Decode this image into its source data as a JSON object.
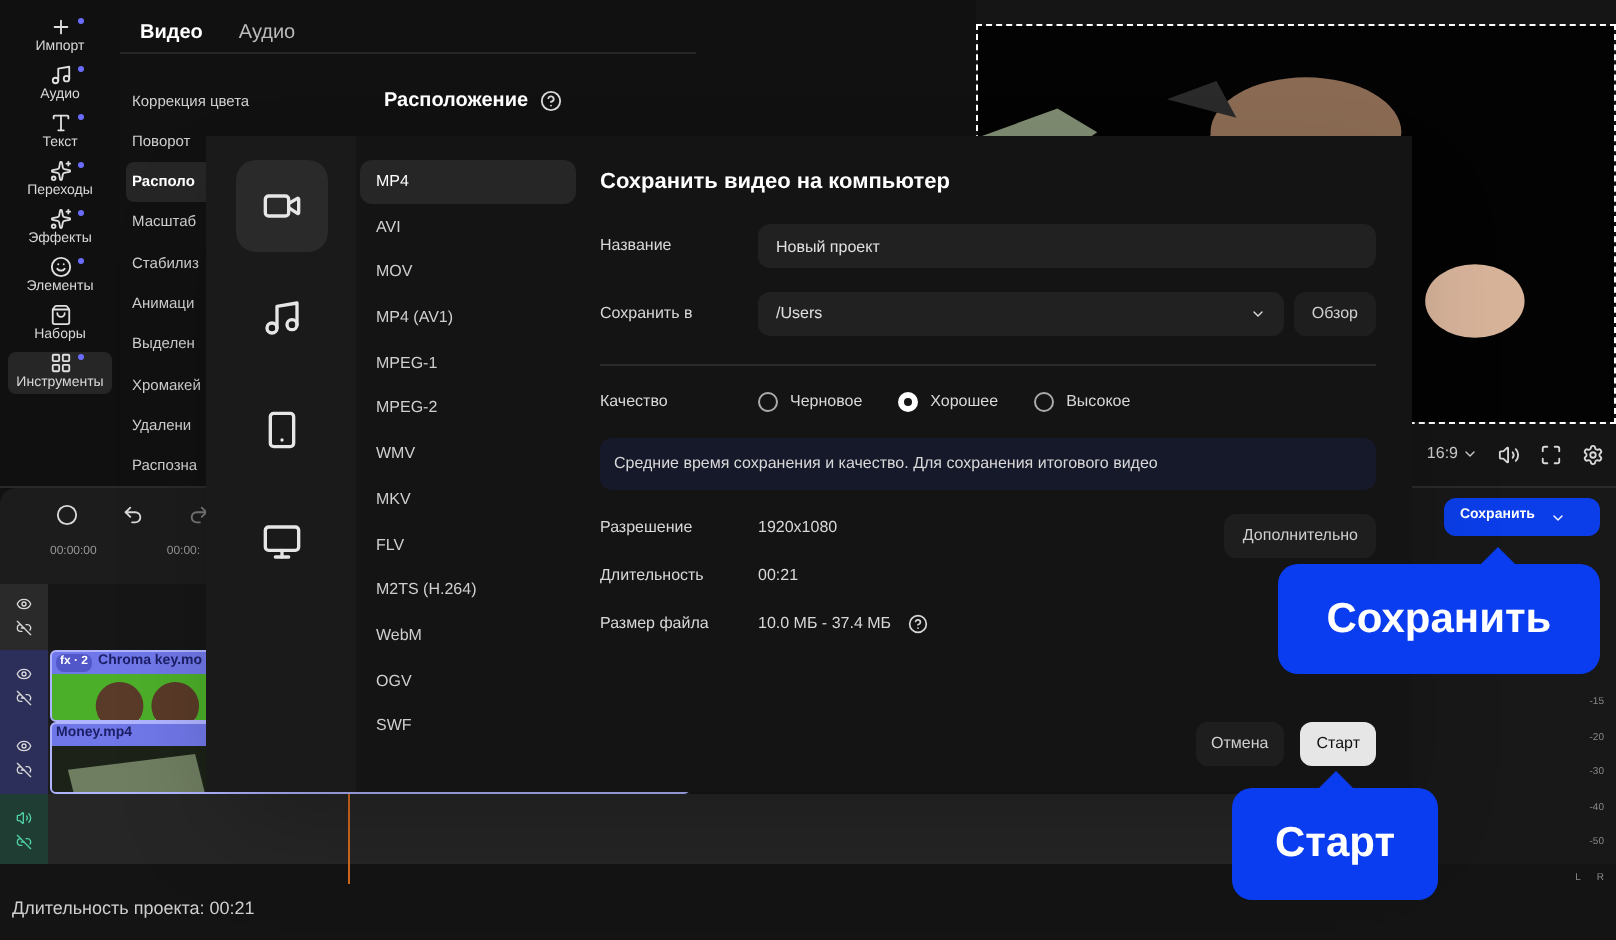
{
  "tool_rail": [
    {
      "label": "Импорт",
      "selected": false,
      "dot": true
    },
    {
      "label": "Аудио",
      "selected": false,
      "dot": true
    },
    {
      "label": "Текст",
      "selected": false,
      "dot": true
    },
    {
      "label": "Переходы",
      "selected": false,
      "dot": true
    },
    {
      "label": "Эффекты",
      "selected": false,
      "dot": true
    },
    {
      "label": "Элементы",
      "selected": false,
      "dot": true
    },
    {
      "label": "Наборы",
      "selected": false,
      "dot": false
    },
    {
      "label": "Инструменты",
      "selected": true,
      "dot": true
    }
  ],
  "settings_panel": {
    "tabs": [
      {
        "label": "Видео",
        "selected": true
      },
      {
        "label": "Аудио",
        "selected": false
      }
    ],
    "items": [
      {
        "label": "Коррекция цвета",
        "selected": false
      },
      {
        "label": "Поворот",
        "selected": false
      },
      {
        "label": "Располо",
        "selected": true
      },
      {
        "label": "Масштаб",
        "selected": false
      },
      {
        "label": "Стабилиз",
        "selected": false
      },
      {
        "label": "Анимаци",
        "selected": false
      },
      {
        "label": "Выделен",
        "selected": false
      },
      {
        "label": "Хромакей",
        "selected": false
      },
      {
        "label": "Удалени",
        "selected": false
      },
      {
        "label": "Распозна",
        "selected": false
      }
    ],
    "section_title": "Расположение"
  },
  "preview": {
    "aspect": "16:9",
    "save_button": "Сохранить"
  },
  "timeline": {
    "times": [
      "00:00:00",
      "00:00:"
    ],
    "clips": [
      {
        "badge": "fx · 2",
        "name": "Chroma key.mo",
        "kind": "chroma"
      },
      {
        "name": "Money.mp4",
        "kind": "money"
      }
    ],
    "meter_labels": [
      "-15",
      "-20",
      "-30",
      "-40",
      "-50"
    ],
    "channels": [
      "L",
      "R"
    ]
  },
  "status_bar": "Длительность проекта: 00:21",
  "export_dialog": {
    "categories": [
      {
        "selected": true
      },
      {
        "selected": false
      },
      {
        "selected": false
      },
      {
        "selected": false
      }
    ],
    "formats": [
      {
        "label": "MP4",
        "selected": true
      },
      {
        "label": "AVI",
        "selected": false
      },
      {
        "label": "MOV",
        "selected": false
      },
      {
        "label": "MP4 (AV1)",
        "selected": false
      },
      {
        "label": "MPEG-1",
        "selected": false
      },
      {
        "label": "MPEG-2",
        "selected": false
      },
      {
        "label": "WMV",
        "selected": false
      },
      {
        "label": "MKV",
        "selected": false
      },
      {
        "label": "FLV",
        "selected": false
      },
      {
        "label": "M2TS (H.264)",
        "selected": false
      },
      {
        "label": "WebM",
        "selected": false
      },
      {
        "label": "OGV",
        "selected": false
      },
      {
        "label": "SWF",
        "selected": false
      }
    ],
    "title": "Сохранить видео на компьютер",
    "name_field": {
      "label": "Название",
      "value": "Новый проект"
    },
    "save_to": {
      "label": "Сохранить в",
      "value": "/Users",
      "browse": "Обзор"
    },
    "quality": {
      "label": "Качество",
      "options": [
        {
          "label": "Черновое",
          "selected": false
        },
        {
          "label": "Хорошее",
          "selected": true
        },
        {
          "label": "Высокое",
          "selected": false
        }
      ]
    },
    "info": "Средние время сохранения и качество. Для сохранения итогового видео",
    "details": [
      {
        "label": "Разрешение",
        "value": "1920x1080"
      },
      {
        "label": "Длительность",
        "value": "00:21"
      },
      {
        "label": "Размер файла",
        "value": "10.0 МБ - 37.4 МБ",
        "help": true
      }
    ],
    "more_button": "Дополнительно",
    "cancel": "Отмена",
    "start": "Старт"
  },
  "callouts": [
    "Сохранить",
    "Старт"
  ]
}
